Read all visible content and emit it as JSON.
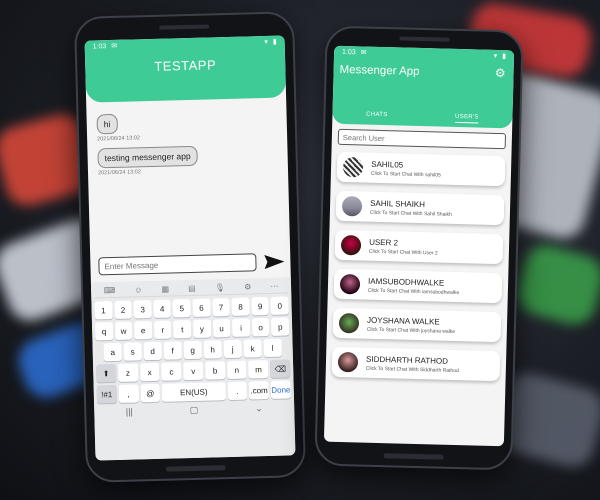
{
  "left_app": {
    "status_time": "1:03",
    "title": "TESTAPP",
    "messages": [
      {
        "text": "hi",
        "timestamp": "2021/06/24 13:02"
      },
      {
        "text": "testing messenger app",
        "timestamp": "2021/06/24 13:02"
      }
    ],
    "input_placeholder": "Enter Message",
    "keyboard": {
      "numbers": [
        "1",
        "2",
        "3",
        "4",
        "5",
        "6",
        "7",
        "8",
        "9",
        "0"
      ],
      "row1": [
        "q",
        "w",
        "e",
        "r",
        "t",
        "y",
        "u",
        "i",
        "o",
        "p"
      ],
      "row2": [
        "a",
        "s",
        "d",
        "f",
        "g",
        "h",
        "j",
        "k",
        "l"
      ],
      "row3": [
        "z",
        "x",
        "c",
        "v",
        "b",
        "n",
        "m"
      ],
      "symbols_key": "!#1",
      "comma_key": ",",
      "at_key": "@",
      "space_key": "EN(US)",
      "period_key": ".",
      "com_key": ".com",
      "done_key": "Done"
    }
  },
  "right_app": {
    "status_time": "1:03",
    "title": "Messenger App",
    "tabs": [
      "CHATS",
      "USER'S"
    ],
    "search_placeholder": "Search User",
    "users": [
      {
        "name": "SAHIL05",
        "subtitle": "Click To Start Chat With sahil05"
      },
      {
        "name": "SAHIL SHAIKH",
        "subtitle": "Click To Start Chat With Sahil Shaikh"
      },
      {
        "name": "USER 2",
        "subtitle": "Click To Start Chat With User 2"
      },
      {
        "name": "IAMSUBODHWALKE",
        "subtitle": "Click To Start Chat With iamsubodhwalke"
      },
      {
        "name": "JOYSHANA WALKE",
        "subtitle": "Click To Start Chat With joyshana walke"
      },
      {
        "name": "SIDDHARTH RATHOD",
        "subtitle": "Click To Start Chat With Siddharth Rathod"
      }
    ]
  },
  "colors": {
    "accent": "#3ecb96",
    "background": "#f4f4f4",
    "bubble": "#e2e2e2"
  }
}
